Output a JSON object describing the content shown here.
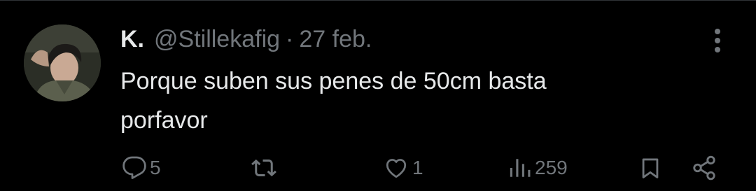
{
  "tweet": {
    "display_name": "K.",
    "handle": "@Stillekafig",
    "separator": "·",
    "date": "27 feb.",
    "text_line1": "Porque suben sus penes de 50cm basta",
    "text_line2": "porfavor"
  },
  "actions": {
    "replies": "5",
    "reposts": "",
    "likes": "1",
    "views": "259"
  },
  "icons": {
    "reply": "comment-icon",
    "repost": "repost-icon",
    "like": "heart-icon",
    "views": "bar-chart-icon",
    "bookmark": "bookmark-icon",
    "share": "share-icon",
    "more": "more-vertical-icon"
  },
  "colors": {
    "background": "#000000",
    "primary_text": "#e7e9ea",
    "secondary_text": "#71767b",
    "divider": "#2f3336"
  }
}
